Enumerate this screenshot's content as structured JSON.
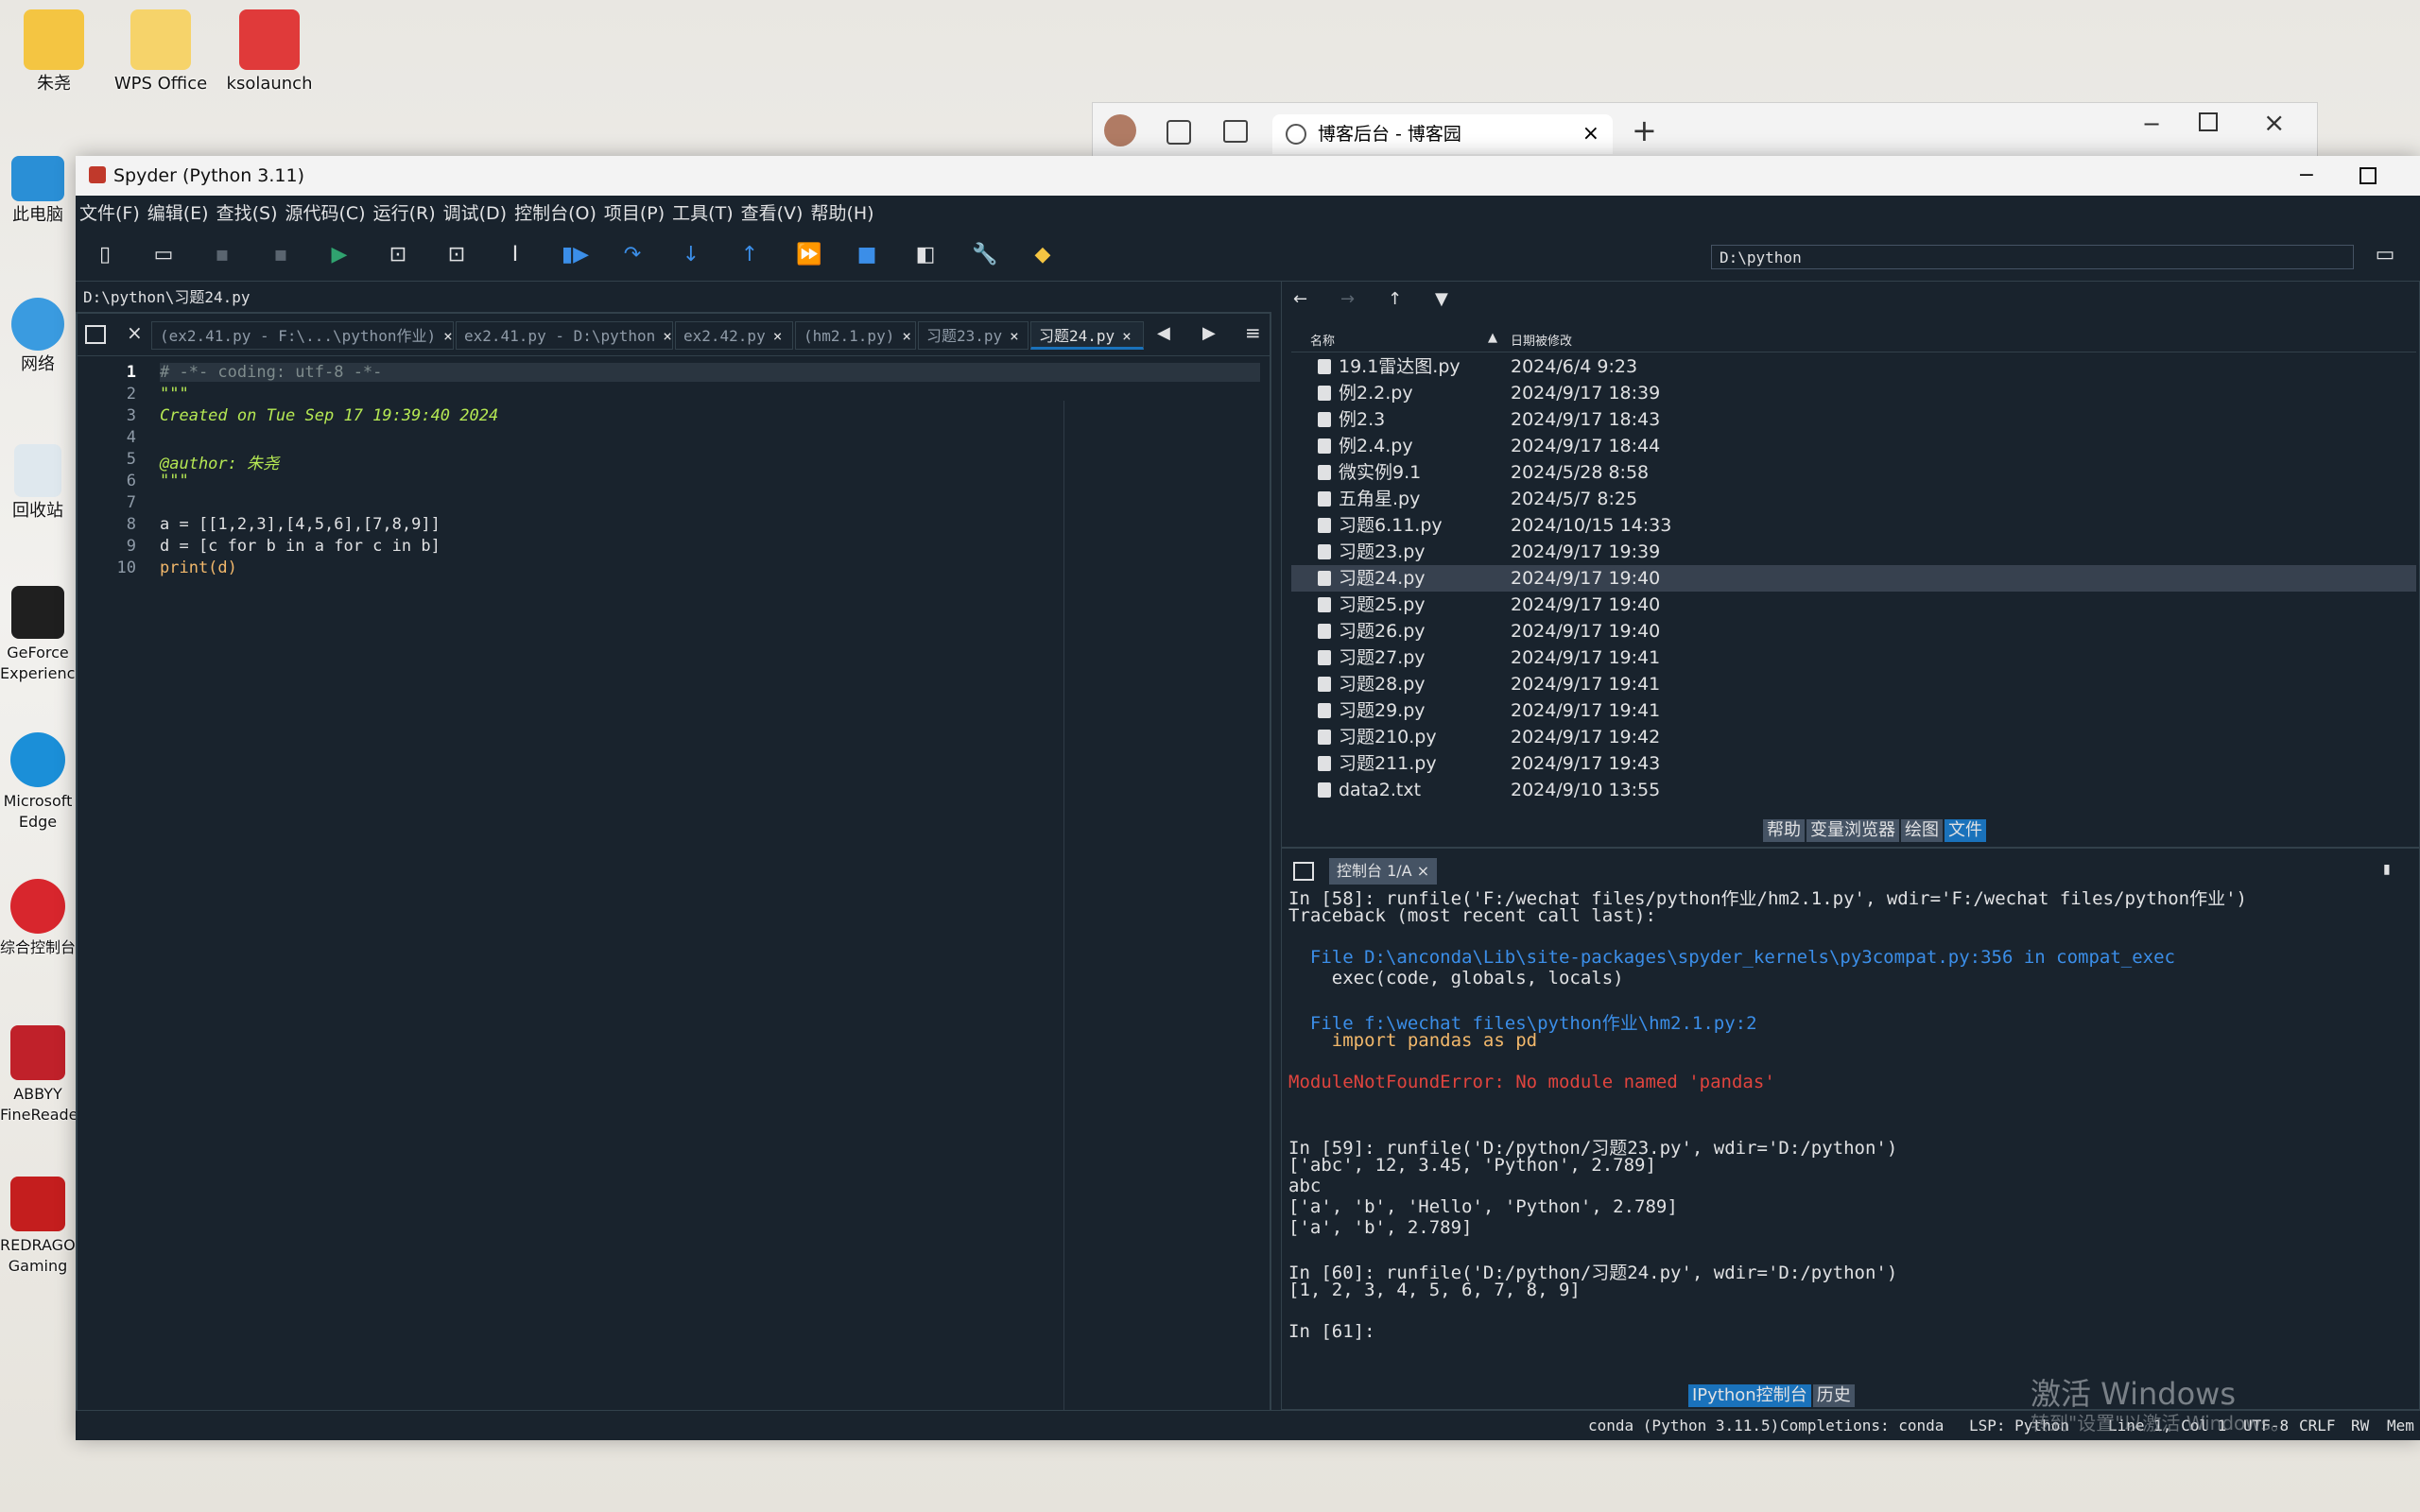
{
  "desktop": {
    "icons": [
      {
        "label": "朱尧"
      },
      {
        "label": "WPS Office"
      },
      {
        "label": "ksolaunch"
      },
      {
        "label": "此电脑"
      },
      {
        "label": "网络"
      },
      {
        "label": "回收站"
      },
      {
        "label": "GeForce Experience"
      },
      {
        "label": "Microsoft Edge"
      },
      {
        "label": "综合控制台"
      },
      {
        "label": "ABBYY FineReader"
      },
      {
        "label": "REDRAGON Gaming"
      }
    ]
  },
  "browser": {
    "tab_title": "博客后台 - 博客园",
    "new_tab": "+"
  },
  "window": {
    "title": "Spyder (Python 3.11)"
  },
  "menu": [
    "文件(F)",
    "编辑(E)",
    "查找(S)",
    "源代码(C)",
    "运行(R)",
    "调试(D)",
    "控制台(O)",
    "项目(P)",
    "工具(T)",
    "查看(V)",
    "帮助(H)"
  ],
  "toolbar": {
    "path": "D:\\python"
  },
  "editor": {
    "path": "D:\\python\\习题24.py",
    "tabs": [
      {
        "label": "(ex2.41.py - F:\\...\\python作业)"
      },
      {
        "label": "ex2.41.py - D:\\python"
      },
      {
        "label": "ex2.42.py"
      },
      {
        "label": "(hm2.1.py)"
      },
      {
        "label": "习题23.py"
      },
      {
        "label": "习题24.py"
      }
    ],
    "line_numbers": [
      "1",
      "2",
      "3",
      "4",
      "5",
      "6",
      "7",
      "8",
      "9",
      "10"
    ],
    "lines": [
      "# -*- coding: utf-8 -*-",
      "\"\"\"",
      "Created on Tue Sep 17 19:39:40 2024",
      "",
      "@author: 朱尧",
      "\"\"\"",
      "",
      "a = [[1,2,3],[4,5,6],[7,8,9]]",
      "d = [c for b in a for c in b]",
      "print(d)"
    ]
  },
  "files": {
    "col_name": "名称",
    "col_date": "日期被修改",
    "rows": [
      {
        "name": "19.1雷达图.py",
        "date": "2024/6/4 9:23"
      },
      {
        "name": "例2.2.py",
        "date": "2024/9/17 18:39"
      },
      {
        "name": "例2.3",
        "date": "2024/9/17 18:43"
      },
      {
        "name": "例2.4.py",
        "date": "2024/9/17 18:44"
      },
      {
        "name": "微实例9.1",
        "date": "2024/5/28 8:58"
      },
      {
        "name": "五角星.py",
        "date": "2024/5/7 8:25"
      },
      {
        "name": "习题6.11.py",
        "date": "2024/10/15 14:33"
      },
      {
        "name": "习题23.py",
        "date": "2024/9/17 19:39"
      },
      {
        "name": "习题24.py",
        "date": "2024/9/17 19:40"
      },
      {
        "name": "习题25.py",
        "date": "2024/9/17 19:40"
      },
      {
        "name": "习题26.py",
        "date": "2024/9/17 19:40"
      },
      {
        "name": "习题27.py",
        "date": "2024/9/17 19:41"
      },
      {
        "name": "习题28.py",
        "date": "2024/9/17 19:41"
      },
      {
        "name": "习题29.py",
        "date": "2024/9/17 19:41"
      },
      {
        "name": "习题210.py",
        "date": "2024/9/17 19:42"
      },
      {
        "name": "习题211.py",
        "date": "2024/9/17 19:43"
      },
      {
        "name": "data2.txt",
        "date": "2024/9/10 13:55"
      }
    ],
    "pane_tabs": [
      "帮助",
      "变量浏览器",
      "绘图",
      "文件"
    ]
  },
  "console": {
    "tab": "控制台 1/A",
    "lines": [
      "In [58]: runfile('F:/wechat files/python作业/hm2.1.py', wdir='F:/wechat files/python作业')",
      "Traceback (most recent call last):",
      "",
      "  File D:\\anconda\\Lib\\site-packages\\spyder_kernels\\py3compat.py:356 in compat_exec",
      "    exec(code, globals, locals)",
      "",
      "  File f:\\wechat files\\python作业\\hm2.1.py:2",
      "    import pandas as pd",
      "",
      "ModuleNotFoundError: No module named 'pandas'",
      "",
      "",
      "In [59]: runfile('D:/python/习题23.py', wdir='D:/python')",
      "['abc', 12, 3.45, 'Python', 2.789]",
      "abc",
      "['a', 'b', 'Hello', 'Python', 2.789]",
      "['a', 'b', 2.789]",
      "",
      "In [60]: runfile('D:/python/习题24.py', wdir='D:/python')",
      "[1, 2, 3, 4, 5, 6, 7, 8, 9]",
      "",
      "In [61]: "
    ],
    "bottom_tabs": [
      "IPython控制台",
      "历史"
    ]
  },
  "status": {
    "conda": "conda (Python 3.11.5)",
    "completions": "Completions: conda",
    "lsp": "LSP: Python",
    "position": "Line 1, Col 1",
    "encoding": "UTF-8",
    "eol": "CRLF",
    "rw": "RW",
    "mem": "Mem"
  },
  "watermark": {
    "title": "激活 Windows",
    "subtitle": "转到\"设置\"以激活 Windows。"
  }
}
